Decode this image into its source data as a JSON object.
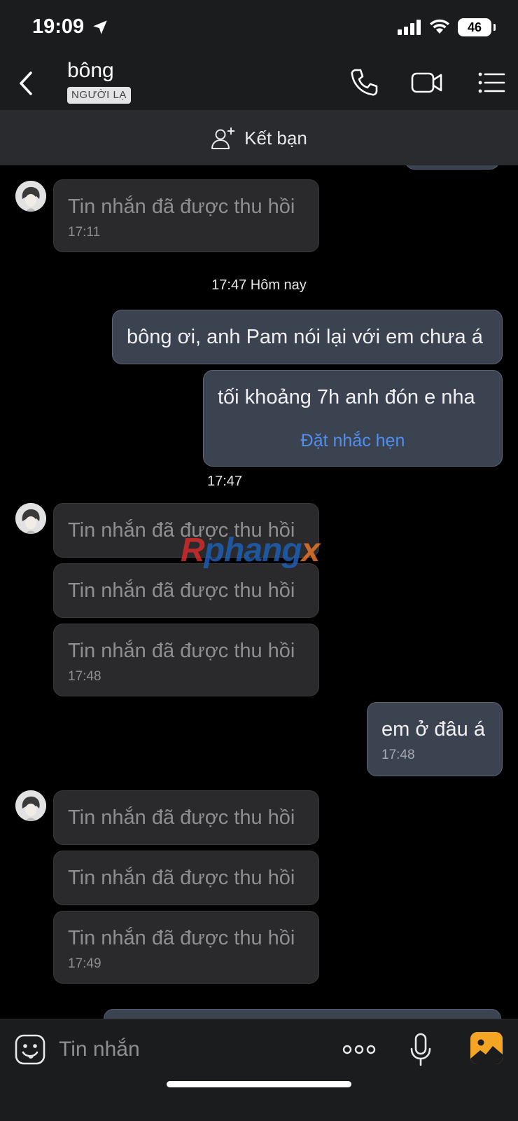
{
  "status_bar": {
    "time": "19:09",
    "battery": "46"
  },
  "header": {
    "contact_name": "bông",
    "badge": "NGƯỜI LẠ"
  },
  "friend_bar": {
    "label": "Kết bạn"
  },
  "messages": {
    "recalled_text": "Tin nhắn đã được thu hồi",
    "group1_time": "17:11",
    "divider": "17:47 Hôm nay",
    "out1": "bông ơi, anh Pam nói lại với em chưa á",
    "out2": "tối khoảng 7h anh đón e nha",
    "reminder_link": "Đặt nhắc hẹn",
    "out2_time": "17:47",
    "group2_time": "17:48",
    "out3": "em ở đâu á",
    "out3_time": "17:48",
    "group3_time": "17:49"
  },
  "watermark": {
    "part1": "R",
    "part2": "phang",
    "part3": "x"
  },
  "input_bar": {
    "placeholder": "Tin nhắn"
  },
  "colors": {
    "accent": "#4f8ff0",
    "photo_button": "#f5a524",
    "outgoing_bubble": "#3b4250"
  }
}
